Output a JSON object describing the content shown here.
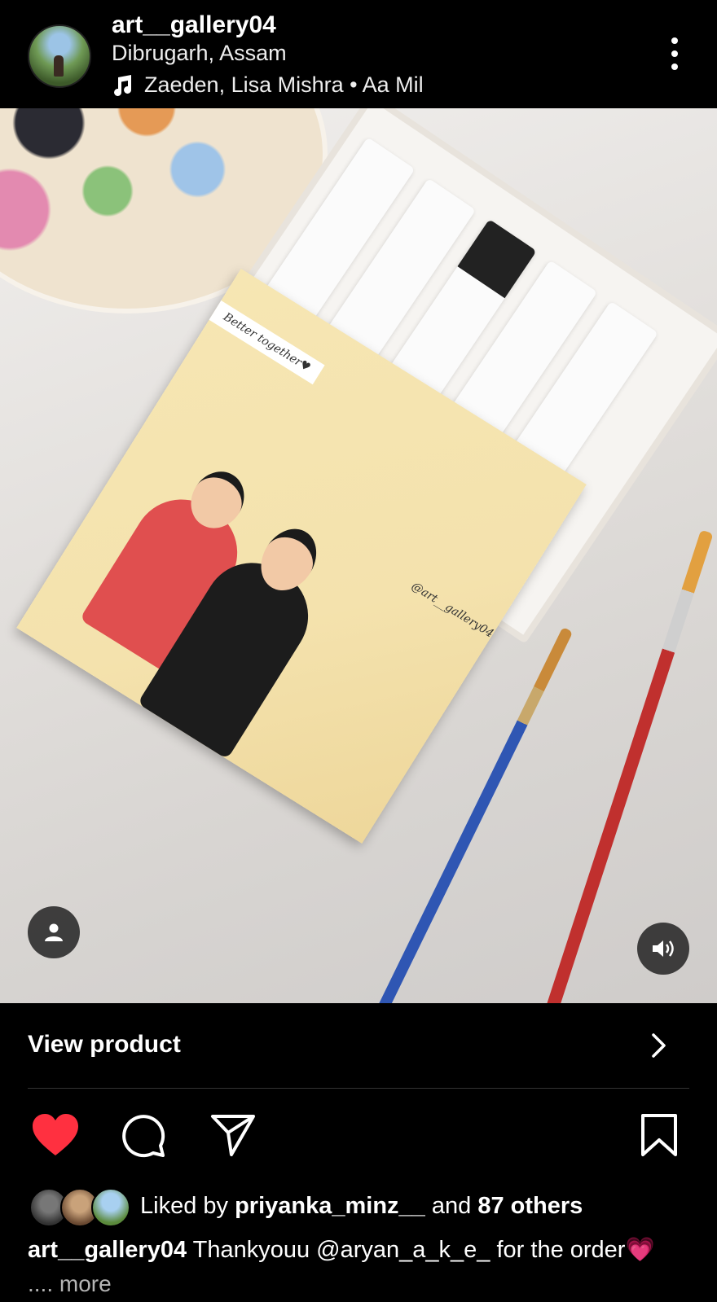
{
  "post": {
    "username": "art__gallery04",
    "location": "Dibrugarh, Assam",
    "audio": "Zaeden, Lisa Mishra • Aa Mil"
  },
  "artwork": {
    "tag_text": "Better together♥",
    "watermark": "@art__gallery04"
  },
  "shopping": {
    "view_product_label": "View product"
  },
  "likes": {
    "prefix": "Liked by",
    "top_liker": "priyanka_minz__",
    "conjunction": "and",
    "others": "87 others"
  },
  "caption": {
    "username": "art__gallery04",
    "text": "Thankyouu @aryan_a_k_e_ for the order💗",
    "more_label": ".... more"
  },
  "colors": {
    "like_active": "#ff3040",
    "background": "#000000",
    "text": "#ffffff"
  },
  "icons": {
    "music": "music-note-icon",
    "menu": "more-vertical-icon",
    "tag": "person-tag-icon",
    "sound": "volume-icon",
    "chevron": "chevron-right-icon",
    "like": "heart-filled-icon",
    "comment": "comment-icon",
    "share": "send-icon",
    "save": "bookmark-icon"
  }
}
